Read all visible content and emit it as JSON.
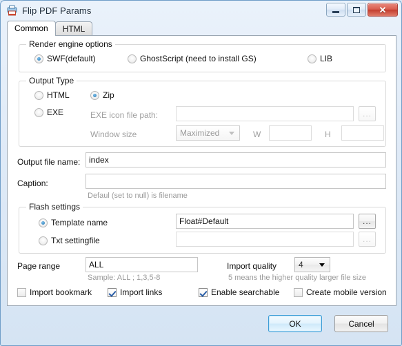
{
  "window": {
    "title": "Flip PDF Params",
    "icon": "printer-book-icon",
    "buttons": {
      "minimize": "minimize-icon",
      "maximize": "maximize-icon",
      "close": "✕"
    }
  },
  "tabs": [
    {
      "label": "Common",
      "active": true
    },
    {
      "label": "HTML",
      "active": false
    }
  ],
  "render_engine": {
    "legend": "Render engine options",
    "options": [
      {
        "label": "SWF(default)",
        "selected": true
      },
      {
        "label": "GhostScript (need to install GS)",
        "selected": false
      },
      {
        "label": "LIB",
        "selected": false
      }
    ]
  },
  "output_type": {
    "legend": "Output Type",
    "options": [
      {
        "label": "HTML",
        "selected": false
      },
      {
        "label": "Zip",
        "selected": true
      },
      {
        "label": "EXE",
        "selected": false
      }
    ],
    "icon_path_label": "EXE icon file path:",
    "icon_path_value": "",
    "icon_browse_label": "...",
    "window_size_label": "Window size",
    "window_size_value": "Maximized",
    "width_label": "W",
    "width_value": "",
    "height_label": "H",
    "height_value": ""
  },
  "output_file": {
    "label": "Output file name:",
    "value": "index"
  },
  "caption": {
    "label": "Caption:",
    "value": "",
    "hint": "Defaul (set to null) is filename"
  },
  "flash_settings": {
    "legend": "Flash settings",
    "template": {
      "label": "Template name",
      "selected": true,
      "value": "Float#Default",
      "browse_label": "..."
    },
    "txt_setting": {
      "label": "Txt settingfile",
      "selected": false,
      "value": "",
      "browse_label": "..."
    }
  },
  "page_range": {
    "label": "Page range",
    "value": "ALL",
    "hint": "Sample: ALL ; 1,3,5-8"
  },
  "import_quality": {
    "label": "Import quality",
    "value": "4",
    "hint": "5 means the higher quality larger file size"
  },
  "checkboxes": [
    {
      "label": "Import bookmark",
      "checked": false
    },
    {
      "label": "Import links",
      "checked": true
    },
    {
      "label": "Enable searchable",
      "checked": true
    },
    {
      "label": "Create mobile version",
      "checked": false
    }
  ],
  "footer": {
    "ok_label": "OK",
    "cancel_label": "Cancel"
  },
  "colors": {
    "accent": "#1f6ea8",
    "close_button": "#c23d2e",
    "default_button_border": "#3c9cd6"
  }
}
